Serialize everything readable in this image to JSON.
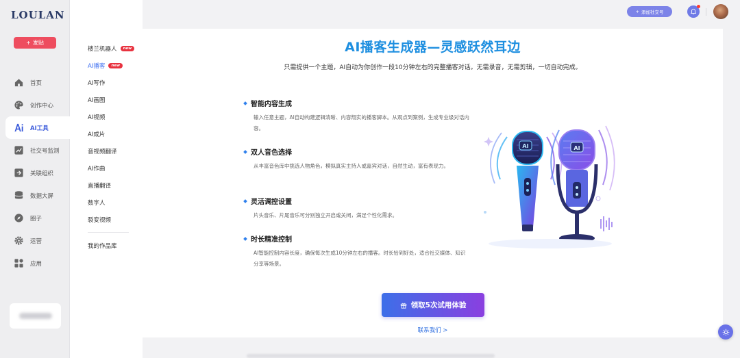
{
  "brand": {
    "logo": "LOULAN"
  },
  "sidebar": {
    "post_label": "发贴",
    "items": [
      {
        "label": "首页",
        "icon": "home-icon"
      },
      {
        "label": "创作中心",
        "icon": "palette-icon"
      },
      {
        "label": "AI工具",
        "icon": "ai-icon",
        "active": true
      },
      {
        "label": "社交号监测",
        "icon": "chart-icon"
      },
      {
        "label": "关联组织",
        "icon": "link-org-icon"
      },
      {
        "label": "数据大屏",
        "icon": "database-icon"
      },
      {
        "label": "圈子",
        "icon": "compass-icon"
      },
      {
        "label": "运营",
        "icon": "gear-icon"
      },
      {
        "label": "应用",
        "icon": "apps-icon"
      }
    ]
  },
  "submenu": {
    "items": [
      {
        "label": "楼兰机器人",
        "badge": "new"
      },
      {
        "label": "AI播客",
        "badge": "new",
        "active": true
      },
      {
        "label": "AI写作"
      },
      {
        "label": "AI画图"
      },
      {
        "label": "AI视频"
      },
      {
        "label": "AI成片"
      },
      {
        "label": "音视频翻译"
      },
      {
        "label": "AI作曲"
      },
      {
        "label": "直播翻译"
      },
      {
        "label": "数字人"
      },
      {
        "label": "裂变视频"
      }
    ],
    "library": "我的作品库"
  },
  "topbar": {
    "add_account": "添加社交号"
  },
  "main": {
    "title": "AI播客生成器—灵感跃然耳边",
    "subtitle": "只需提供一个主题，AI自动为你创作一段10分钟左右的完整播客对话。无需录音，无需剪辑，一切自动完成。",
    "features": [
      {
        "title": "智能内容生成",
        "desc": "输入任意主题，AI自动构建逻辑清晰、内容翔实的播客脚本。从观点到案例，生成专业级对话内容。"
      },
      {
        "title": "双人音色选择",
        "desc": "从丰富音色库中挑选人物角色，模拟真实主持人或嘉宾对话，自然生动，富有表现力。"
      },
      {
        "title": "灵活调控设置",
        "desc": "片头音乐、片尾音乐可分别独立开启或关闭，满足个性化需求。"
      },
      {
        "title": "时长精准控制",
        "desc": "AI智能控制内容长度，确保每次生成10分钟左右的播客。时长恰到好处，适合社交媒体、知识分享等场景。"
      }
    ],
    "cta": "领取5次试用体验",
    "contact": "联系我们 >",
    "mic_label_1": "AI",
    "mic_label_2": "AI"
  },
  "colors": {
    "accent": "#3b6df0",
    "title": "#1e8fe0",
    "post": "#ee4d5f",
    "cta_start": "#3d6fe8",
    "cta_end": "#8a3fe0"
  }
}
